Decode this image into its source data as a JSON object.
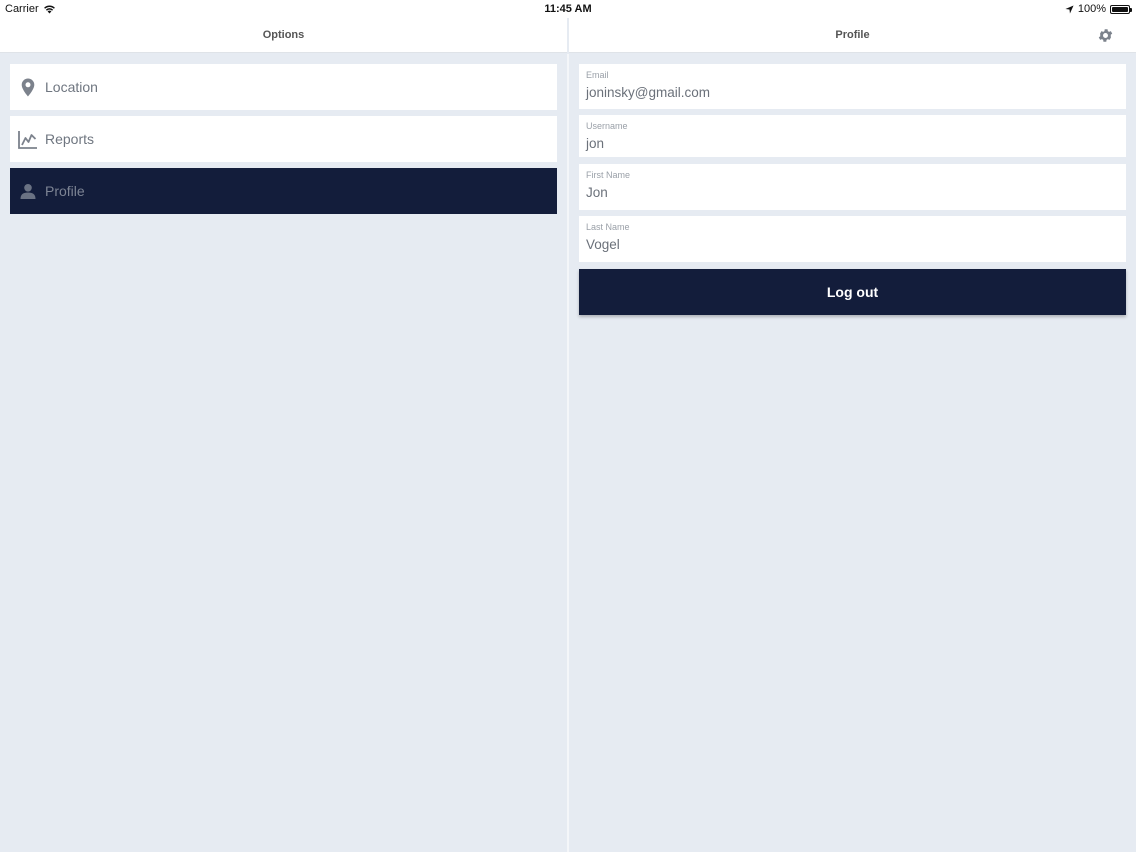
{
  "status_bar": {
    "carrier": "Carrier",
    "time": "11:45 AM",
    "battery": "100%"
  },
  "left_nav": {
    "title": "Options"
  },
  "right_nav": {
    "title": "Profile",
    "settings_icon": "gear-icon"
  },
  "menu": {
    "items": [
      {
        "label": "Location",
        "icon": "location-pin-icon",
        "selected": false
      },
      {
        "label": "Reports",
        "icon": "chart-icon",
        "selected": false
      },
      {
        "label": "Profile",
        "icon": "person-icon",
        "selected": true
      }
    ]
  },
  "profile": {
    "fields": [
      {
        "label": "Email",
        "value": "joninsky@gmail.com"
      },
      {
        "label": "Username",
        "value": "jon"
      },
      {
        "label": "First Name",
        "value": "Jon"
      },
      {
        "label": "Last Name",
        "value": "Vogel"
      }
    ],
    "logout_label": "Log out"
  },
  "colors": {
    "accent_dark": "#131d3b",
    "background": "#e6ebf2",
    "card": "#ffffff"
  }
}
